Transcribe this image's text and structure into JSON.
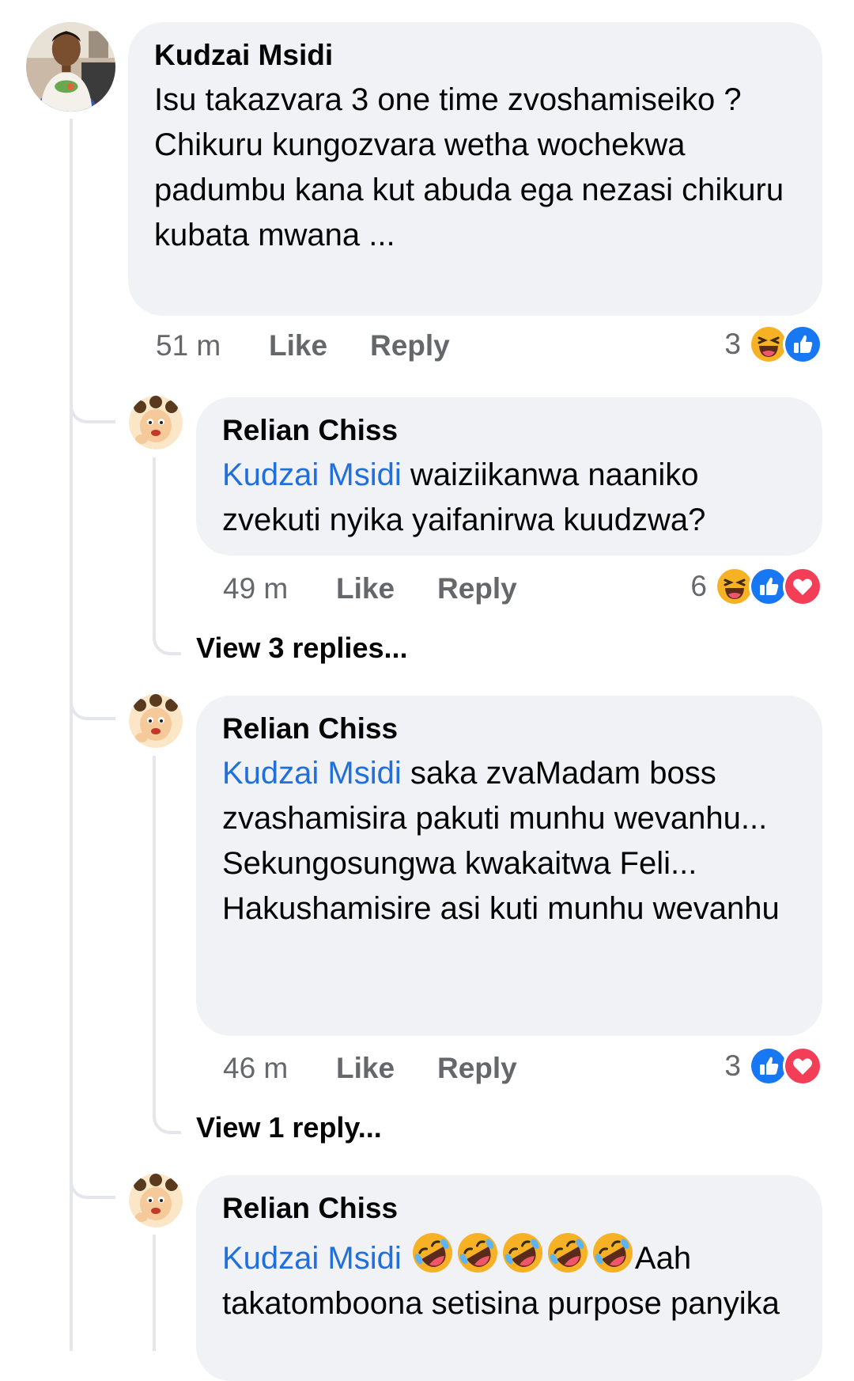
{
  "comments": [
    {
      "author": "Kudzai Msidi",
      "text": "Isu takazvara 3 one time zvoshamiseiko ? Chikuru kungozvara wetha wochekwa padumbu kana kut abuda ega nezasi chikuru kubata mwana ...",
      "time": "51 m",
      "like_label": "Like",
      "reply_label": "Reply",
      "reaction_count": "3",
      "reaction_icons": [
        "haha-icon",
        "like-reaction-icon"
      ]
    }
  ],
  "replies": [
    {
      "author": "Relian Chiss",
      "mention": "Kudzai Msidi",
      "text": " waiziikanwa naaniko zvekuti nyika yaifanirwa kuudzwa?",
      "time": "49 m",
      "like_label": "Like",
      "reply_label": "Reply",
      "reaction_count": "6",
      "reaction_icons": [
        "haha-icon",
        "like-reaction-icon",
        "love-icon"
      ],
      "view_replies": "View 3 replies..."
    },
    {
      "author": "Relian Chiss",
      "mention": "Kudzai Msidi",
      "text": " saka zvaMadam boss zvashamisira pakuti munhu wevanhu...\nSekungosungwa kwakaitwa Feli...\nHakushamisire asi kuti munhu wevanhu",
      "time": "46 m",
      "like_label": "Like",
      "reply_label": "Reply",
      "reaction_count": "3",
      "reaction_icons": [
        "like-reaction-icon",
        "love-icon"
      ],
      "view_replies": "View 1 reply..."
    },
    {
      "author": "Relian Chiss",
      "mention": "Kudzai Msidi",
      "emoji": "rolling-on-floor-laughing-icon",
      "emoji_repeat": 5,
      "text": "Aah takatomboona setisina purpose panyika"
    }
  ],
  "colors": {
    "bubble": "#f0f2f5",
    "mention": "#216fdb",
    "meta": "#65676b",
    "like_blue": "#1877f2",
    "love_red": "#f33e58",
    "haha_yellow": "#f7b125"
  }
}
